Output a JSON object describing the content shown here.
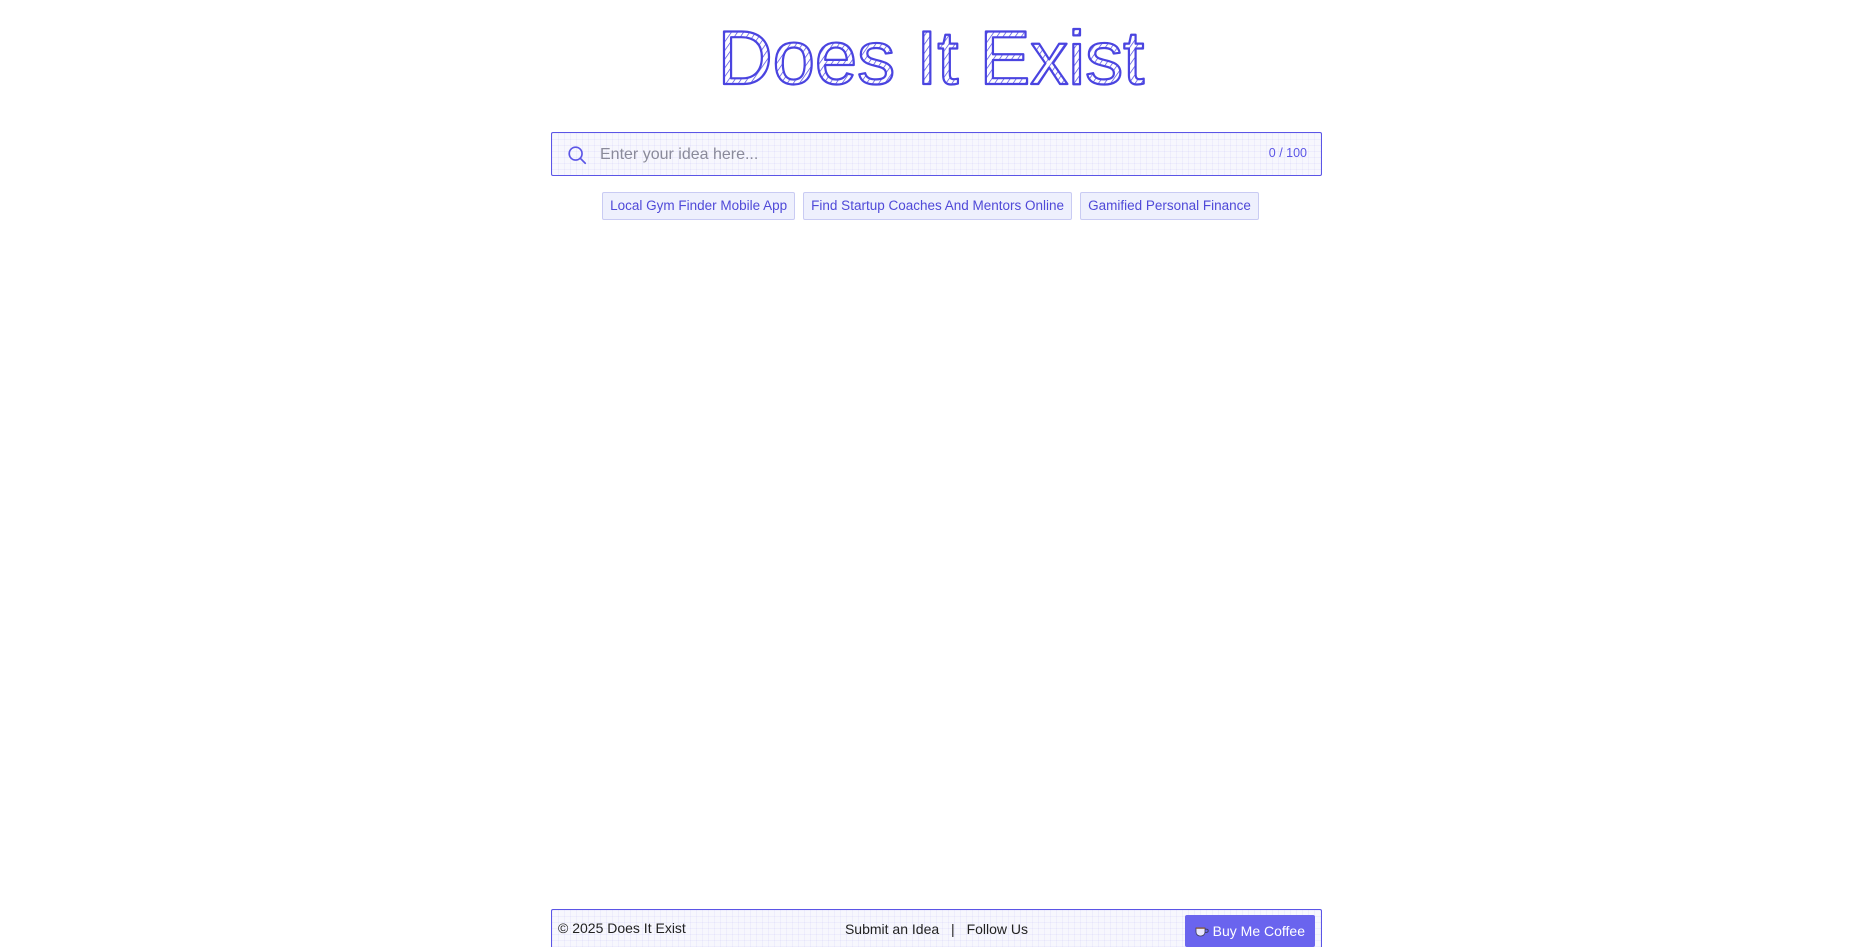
{
  "title": "Does It Exist",
  "search": {
    "placeholder": "Enter your idea here...",
    "value": "",
    "counter": "0 / 100",
    "icon": "search-icon"
  },
  "suggestions": [
    "Local Gym Finder Mobile App",
    "Find Startup Coaches And Mentors Online",
    "Gamified Personal Finance"
  ],
  "footer": {
    "copyright": "© 2025 Does It Exist",
    "submit_label": "Submit an Idea",
    "separator": "|",
    "follow_label": "Follow Us",
    "coffee_icon": "coffee-cup-icon",
    "coffee_label": "Buy Me Coffee"
  },
  "colors": {
    "accent": "#5b55e6",
    "chip_bg": "#eef0fd",
    "button_bg": "#6a64ee"
  }
}
